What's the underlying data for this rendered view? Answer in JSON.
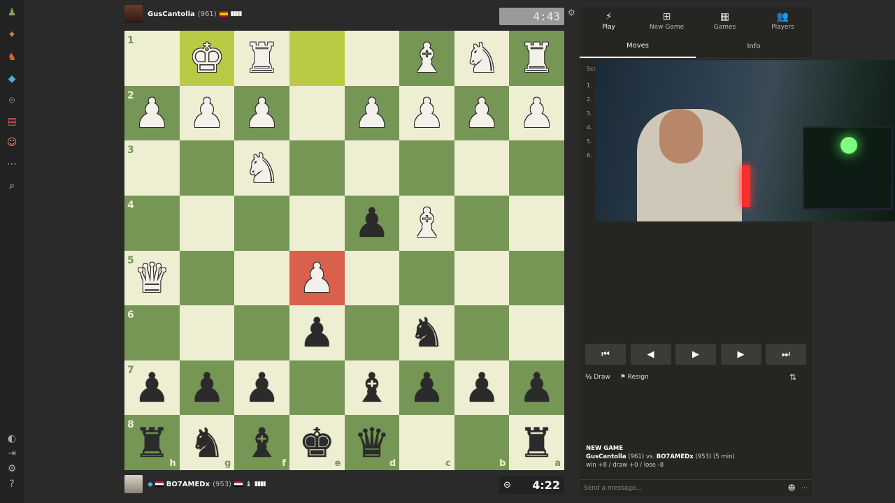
{
  "top_player": {
    "name": "GusCantolla",
    "rating": "(961)",
    "clock": "4:43"
  },
  "bottom_player": {
    "name": "BO7AMEDx",
    "rating": "(953)",
    "clock": "4:22"
  },
  "board": {
    "ranks": [
      "1",
      "2",
      "3",
      "4",
      "5",
      "6",
      "7",
      "8"
    ],
    "files": [
      "h",
      "g",
      "f",
      "e",
      "d",
      "c",
      "b",
      "a"
    ],
    "rows": [
      [
        "",
        "wK",
        "wR",
        "",
        "",
        "wB",
        "wN",
        "wR"
      ],
      [
        "wP",
        "wP",
        "wP",
        "",
        "wP",
        "wP",
        "wP",
        "wP"
      ],
      [
        "",
        "",
        "wN",
        "",
        "",
        "",
        "",
        ""
      ],
      [
        "",
        "",
        "",
        "",
        "bP",
        "wB",
        "",
        ""
      ],
      [
        "wQ",
        "",
        "",
        "wP",
        "",
        "",
        "",
        ""
      ],
      [
        "",
        "",
        "",
        "bP",
        "",
        "bN",
        "",
        ""
      ],
      [
        "bP",
        "bP",
        "bP",
        "",
        "bB",
        "bP",
        "bP",
        "bP"
      ],
      [
        "bR",
        "bN",
        "bB",
        "bK",
        "bQ",
        "",
        "",
        "bR"
      ]
    ]
  },
  "right_nav": [
    {
      "label": "Play",
      "icon": "lightning-icon",
      "glyph": "⚡"
    },
    {
      "label": "New Game",
      "icon": "plus-square-icon",
      "glyph": "⊞"
    },
    {
      "label": "Games",
      "icon": "board-icon",
      "glyph": "▦"
    },
    {
      "label": "Players",
      "icon": "players-icon",
      "glyph": "👥"
    }
  ],
  "tabs": [
    "Moves",
    "Info"
  ],
  "move_numbers": [
    "1.",
    "2.",
    "3.",
    "4.",
    "5.",
    "6."
  ],
  "move_list_header": "Sca",
  "controls": [
    "⏮",
    "◀",
    "▶",
    "▶",
    "⏭"
  ],
  "actions": {
    "draw": "Draw",
    "draw_glyph": "½",
    "resign": "Resign"
  },
  "chat": {
    "header": "NEW GAME",
    "line1_p1": "GusCantolla",
    "line1_r1": "(961) vs.",
    "line1_p2": "BO7AMEDx",
    "line1_r2": "(953) (5 min)",
    "line2": "win +8 / draw +0 / lose -8",
    "placeholder": "Send a message..."
  }
}
